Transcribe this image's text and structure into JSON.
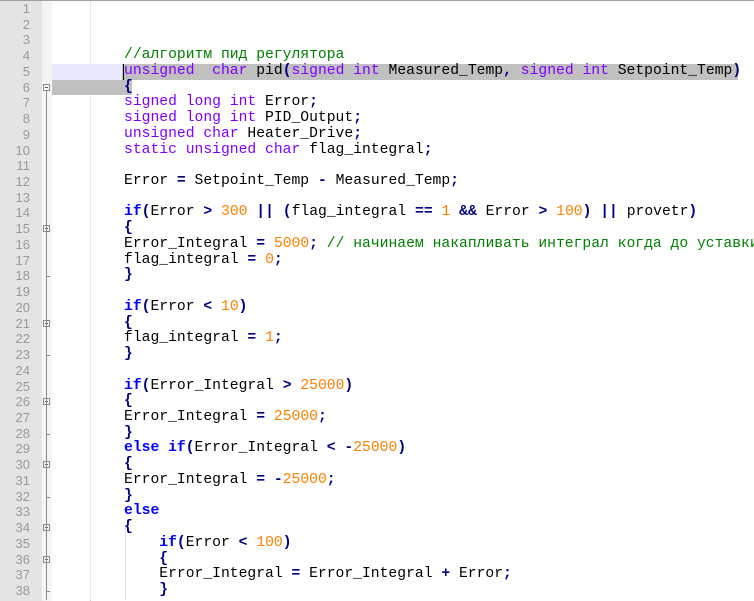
{
  "editor": {
    "current_line": 5,
    "lines": [
      {
        "n": "1",
        "t": []
      },
      {
        "n": "2",
        "t": []
      },
      {
        "n": "3",
        "t": []
      },
      {
        "n": "4",
        "t": [
          [
            "c",
            "//алгоритм пид регулятора"
          ]
        ]
      },
      {
        "n": "5",
        "t": [
          [
            "k",
            "unsigned"
          ],
          [
            "",
            "  "
          ],
          [
            "k",
            "char"
          ],
          [
            "",
            " pid"
          ],
          [
            "o",
            "("
          ],
          [
            "k",
            "signed"
          ],
          [
            "",
            " "
          ],
          [
            "k",
            "int"
          ],
          [
            "",
            " Measured_Temp"
          ],
          [
            "o",
            ","
          ],
          [
            "",
            " "
          ],
          [
            "k",
            "signed"
          ],
          [
            "",
            " "
          ],
          [
            "k",
            "int"
          ],
          [
            "",
            " Setpoint_Temp"
          ],
          [
            "o",
            ")"
          ]
        ]
      },
      {
        "n": "6",
        "t": [
          [
            "o",
            "{"
          ]
        ],
        "fold": "start"
      },
      {
        "n": "7",
        "t": [
          [
            "k",
            "signed long int"
          ],
          [
            "",
            " Error"
          ],
          [
            "o",
            ";"
          ]
        ]
      },
      {
        "n": "8",
        "t": [
          [
            "k",
            "signed long int"
          ],
          [
            "",
            " PID_Output"
          ],
          [
            "o",
            ";"
          ]
        ]
      },
      {
        "n": "9",
        "t": [
          [
            "k",
            "unsigned char"
          ],
          [
            "",
            " Heater_Drive"
          ],
          [
            "o",
            ";"
          ]
        ]
      },
      {
        "n": "10",
        "t": [
          [
            "k",
            "static unsigned char"
          ],
          [
            "",
            " flag_integral"
          ],
          [
            "o",
            ";"
          ]
        ]
      },
      {
        "n": "11",
        "t": []
      },
      {
        "n": "12",
        "t": [
          [
            "",
            "Error "
          ],
          [
            "o",
            "="
          ],
          [
            "",
            " Setpoint_Temp "
          ],
          [
            "o",
            "-"
          ],
          [
            "",
            " Measured_Temp"
          ],
          [
            "o",
            ";"
          ]
        ]
      },
      {
        "n": "13",
        "t": []
      },
      {
        "n": "14",
        "t": [
          [
            "i",
            "if"
          ],
          [
            "o",
            "("
          ],
          [
            "",
            "Error "
          ],
          [
            "o",
            ">"
          ],
          [
            "",
            " "
          ],
          [
            "n",
            "300"
          ],
          [
            "",
            " "
          ],
          [
            "o",
            "||"
          ],
          [
            "",
            " "
          ],
          [
            "o",
            "("
          ],
          [
            "",
            "flag_integral "
          ],
          [
            "o",
            "=="
          ],
          [
            "",
            " "
          ],
          [
            "n",
            "1"
          ],
          [
            "",
            " "
          ],
          [
            "o",
            "&&"
          ],
          [
            "",
            " Error "
          ],
          [
            "o",
            ">"
          ],
          [
            "",
            " "
          ],
          [
            "n",
            "100"
          ],
          [
            "o",
            ")"
          ],
          [
            "",
            " "
          ],
          [
            "o",
            "||"
          ],
          [
            "",
            " provetr"
          ],
          [
            "o",
            ")"
          ]
        ]
      },
      {
        "n": "15",
        "t": [
          [
            "o",
            "{"
          ]
        ],
        "fold": "start"
      },
      {
        "n": "16",
        "t": [
          [
            "",
            "Error_Integral "
          ],
          [
            "o",
            "="
          ],
          [
            "",
            " "
          ],
          [
            "n",
            "5000"
          ],
          [
            "o",
            ";"
          ],
          [
            "",
            " "
          ],
          [
            "c",
            "// начинаем накапливать интеграл когда до уставки"
          ]
        ]
      },
      {
        "n": "17",
        "t": [
          [
            "",
            "flag_integral "
          ],
          [
            "o",
            "="
          ],
          [
            "",
            " "
          ],
          [
            "n",
            "0"
          ],
          [
            "o",
            ";"
          ]
        ]
      },
      {
        "n": "18",
        "t": [
          [
            "o",
            "}"
          ]
        ],
        "fold": "end"
      },
      {
        "n": "19",
        "t": []
      },
      {
        "n": "20",
        "t": [
          [
            "i",
            "if"
          ],
          [
            "o",
            "("
          ],
          [
            "",
            "Error "
          ],
          [
            "o",
            "<"
          ],
          [
            "",
            " "
          ],
          [
            "n",
            "10"
          ],
          [
            "o",
            ")"
          ]
        ]
      },
      {
        "n": "21",
        "t": [
          [
            "o",
            "{"
          ]
        ],
        "fold": "start"
      },
      {
        "n": "22",
        "t": [
          [
            "",
            "flag_integral "
          ],
          [
            "o",
            "="
          ],
          [
            "",
            " "
          ],
          [
            "n",
            "1"
          ],
          [
            "o",
            ";"
          ]
        ]
      },
      {
        "n": "23",
        "t": [
          [
            "o",
            "}"
          ]
        ],
        "fold": "end"
      },
      {
        "n": "24",
        "t": []
      },
      {
        "n": "25",
        "t": [
          [
            "i",
            "if"
          ],
          [
            "o",
            "("
          ],
          [
            "",
            "Error_Integral "
          ],
          [
            "o",
            ">"
          ],
          [
            "",
            " "
          ],
          [
            "n",
            "25000"
          ],
          [
            "o",
            ")"
          ]
        ]
      },
      {
        "n": "26",
        "t": [
          [
            "o",
            "{"
          ]
        ],
        "fold": "start"
      },
      {
        "n": "27",
        "t": [
          [
            "",
            "Error_Integral "
          ],
          [
            "o",
            "="
          ],
          [
            "",
            " "
          ],
          [
            "n",
            "25000"
          ],
          [
            "o",
            ";"
          ]
        ]
      },
      {
        "n": "28",
        "t": [
          [
            "o",
            "}"
          ]
        ],
        "fold": "end"
      },
      {
        "n": "29",
        "t": [
          [
            "i",
            "else if"
          ],
          [
            "o",
            "("
          ],
          [
            "",
            "Error_Integral "
          ],
          [
            "o",
            "<"
          ],
          [
            "",
            " "
          ],
          [
            "o",
            "-"
          ],
          [
            "n",
            "25000"
          ],
          [
            "o",
            ")"
          ]
        ]
      },
      {
        "n": "30",
        "t": [
          [
            "o",
            "{"
          ]
        ],
        "fold": "start"
      },
      {
        "n": "31",
        "t": [
          [
            "",
            "Error_Integral "
          ],
          [
            "o",
            "="
          ],
          [
            "",
            " "
          ],
          [
            "o",
            "-"
          ],
          [
            "n",
            "25000"
          ],
          [
            "o",
            ";"
          ]
        ]
      },
      {
        "n": "32",
        "t": [
          [
            "o",
            "}"
          ]
        ],
        "fold": "end"
      },
      {
        "n": "33",
        "t": [
          [
            "i",
            "else"
          ]
        ]
      },
      {
        "n": "34",
        "t": [
          [
            "o",
            "{"
          ]
        ],
        "fold": "start"
      },
      {
        "n": "35",
        "t": [
          [
            "",
            "    "
          ],
          [
            "i",
            "if"
          ],
          [
            "o",
            "("
          ],
          [
            "",
            "Error "
          ],
          [
            "o",
            "<"
          ],
          [
            "",
            " "
          ],
          [
            "n",
            "100"
          ],
          [
            "o",
            ")"
          ]
        ]
      },
      {
        "n": "36",
        "t": [
          [
            "",
            "    "
          ],
          [
            "o",
            "{"
          ]
        ],
        "fold": "start"
      },
      {
        "n": "37",
        "t": [
          [
            "",
            "    Error_Integral "
          ],
          [
            "o",
            "="
          ],
          [
            "",
            " Error_Integral "
          ],
          [
            "o",
            "+"
          ],
          [
            "",
            " Error"
          ],
          [
            "o",
            ";"
          ]
        ]
      },
      {
        "n": "38",
        "t": [
          [
            "",
            "    "
          ],
          [
            "o",
            "}"
          ]
        ],
        "fold": "end"
      }
    ]
  }
}
